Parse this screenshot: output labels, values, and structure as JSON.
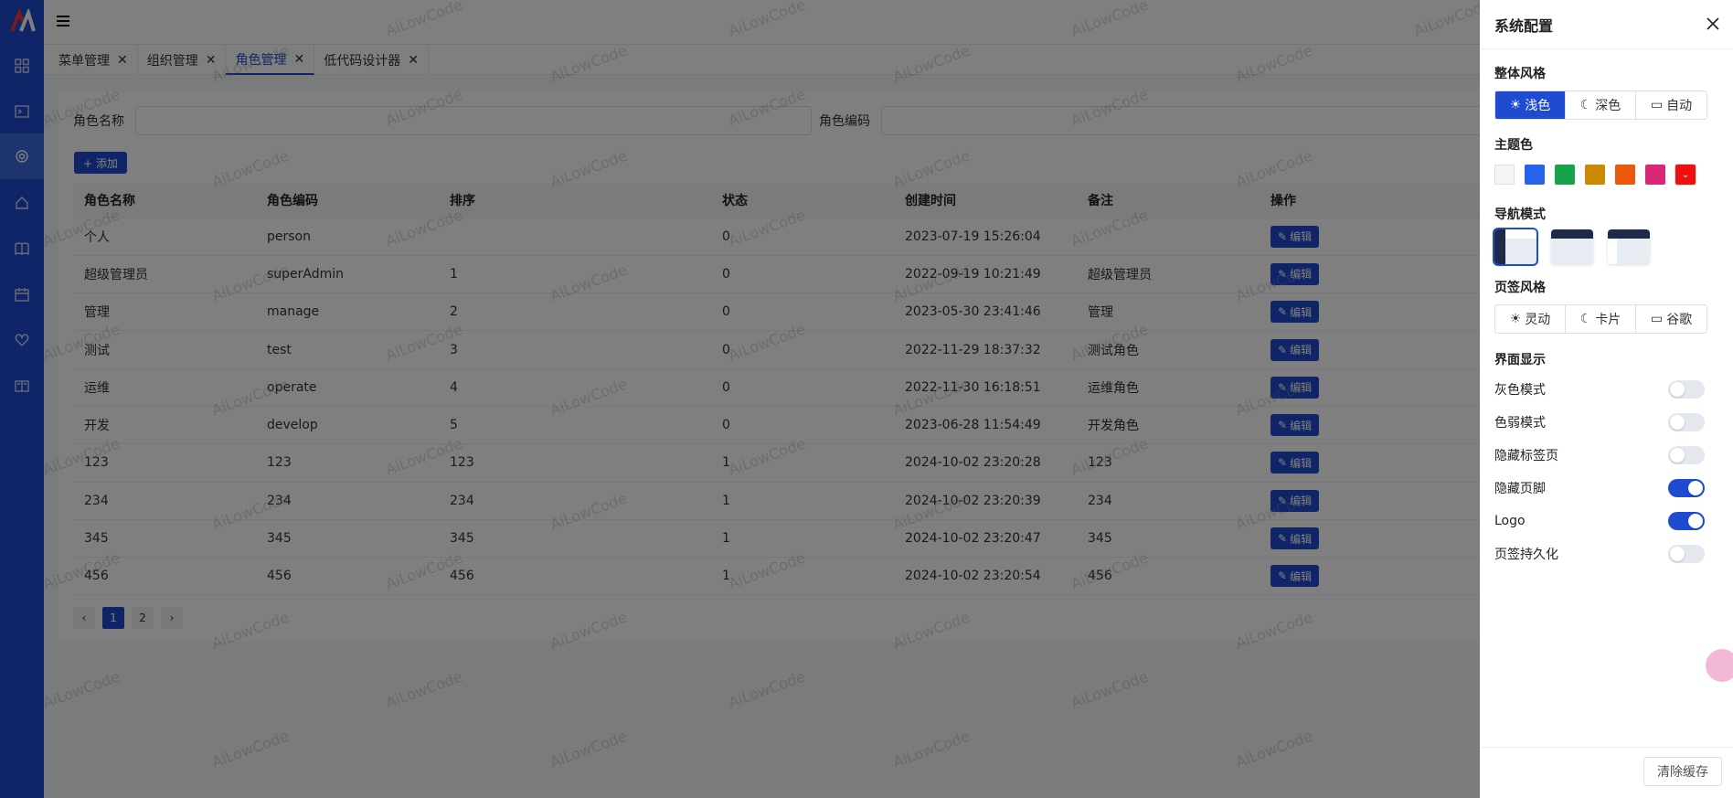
{
  "sidebar": {
    "icons": [
      "dashboard-icon",
      "terminal-icon",
      "gear-icon",
      "home-icon",
      "book-icon",
      "calendar-icon",
      "heart-icon",
      "docs-icon"
    ]
  },
  "tabs": [
    {
      "label": "菜单管理"
    },
    {
      "label": "组织管理"
    },
    {
      "label": "角色管理"
    },
    {
      "label": "低代码设计器"
    }
  ],
  "search": {
    "role_name_label": "角色名称",
    "role_code_label": "角色编码"
  },
  "toolbar": {
    "add_label": "+ 添加"
  },
  "table": {
    "headers": [
      "角色名称",
      "角色编码",
      "排序",
      "状态",
      "创建时间",
      "备注",
      "操作"
    ],
    "edit_label": "编辑",
    "rows": [
      [
        "个人",
        "person",
        "",
        "0",
        "2023-07-19 15:26:04",
        ""
      ],
      [
        "超级管理员",
        "superAdmin",
        "1",
        "0",
        "2022-09-19 10:21:49",
        "超级管理员"
      ],
      [
        "管理",
        "manage",
        "2",
        "0",
        "2023-05-30 23:41:46",
        "管理"
      ],
      [
        "测试",
        "test",
        "3",
        "0",
        "2022-11-29 18:37:32",
        "测试角色"
      ],
      [
        "运维",
        "operate",
        "4",
        "0",
        "2022-11-30 16:18:51",
        "运维角色"
      ],
      [
        "开发",
        "develop",
        "5",
        "0",
        "2023-06-28 11:54:49",
        "开发角色"
      ],
      [
        "123",
        "123",
        "123",
        "1",
        "2024-10-02 23:20:28",
        "123"
      ],
      [
        "234",
        "234",
        "234",
        "1",
        "2024-10-02 23:20:39",
        "234"
      ],
      [
        "345",
        "345",
        "345",
        "1",
        "2024-10-02 23:20:47",
        "345"
      ],
      [
        "456",
        "456",
        "456",
        "1",
        "2024-10-02 23:20:54",
        "456"
      ]
    ]
  },
  "pager": {
    "pages": [
      "1",
      "2"
    ],
    "current": "1"
  },
  "watermark": "AiLowCode",
  "panel": {
    "title": "系统配置",
    "overall_style_label": "整体风格",
    "style_options": [
      "浅色",
      "深色",
      "自动"
    ],
    "theme_color_label": "主题色",
    "theme_colors": [
      "#f5f5f5",
      "#2563eb",
      "#16a34a",
      "#ca8a04",
      "#ea580c",
      "#db2777",
      "#ef0f0f"
    ],
    "nav_mode_label": "导航模式",
    "tab_style_label": "页签风格",
    "tab_style_options": [
      "灵动",
      "卡片",
      "谷歌"
    ],
    "display_label": "界面显示",
    "toggles": [
      {
        "label": "灰色模式",
        "on": false
      },
      {
        "label": "色弱模式",
        "on": false
      },
      {
        "label": "隐藏标签页",
        "on": false
      },
      {
        "label": "隐藏页脚",
        "on": true
      },
      {
        "label": "Logo",
        "on": true
      },
      {
        "label": "页签持久化",
        "on": false
      }
    ],
    "clear_cache_label": "清除缓存"
  },
  "colors": {
    "primary": "#1e4bd0",
    "rail": "#1e4bd0"
  }
}
